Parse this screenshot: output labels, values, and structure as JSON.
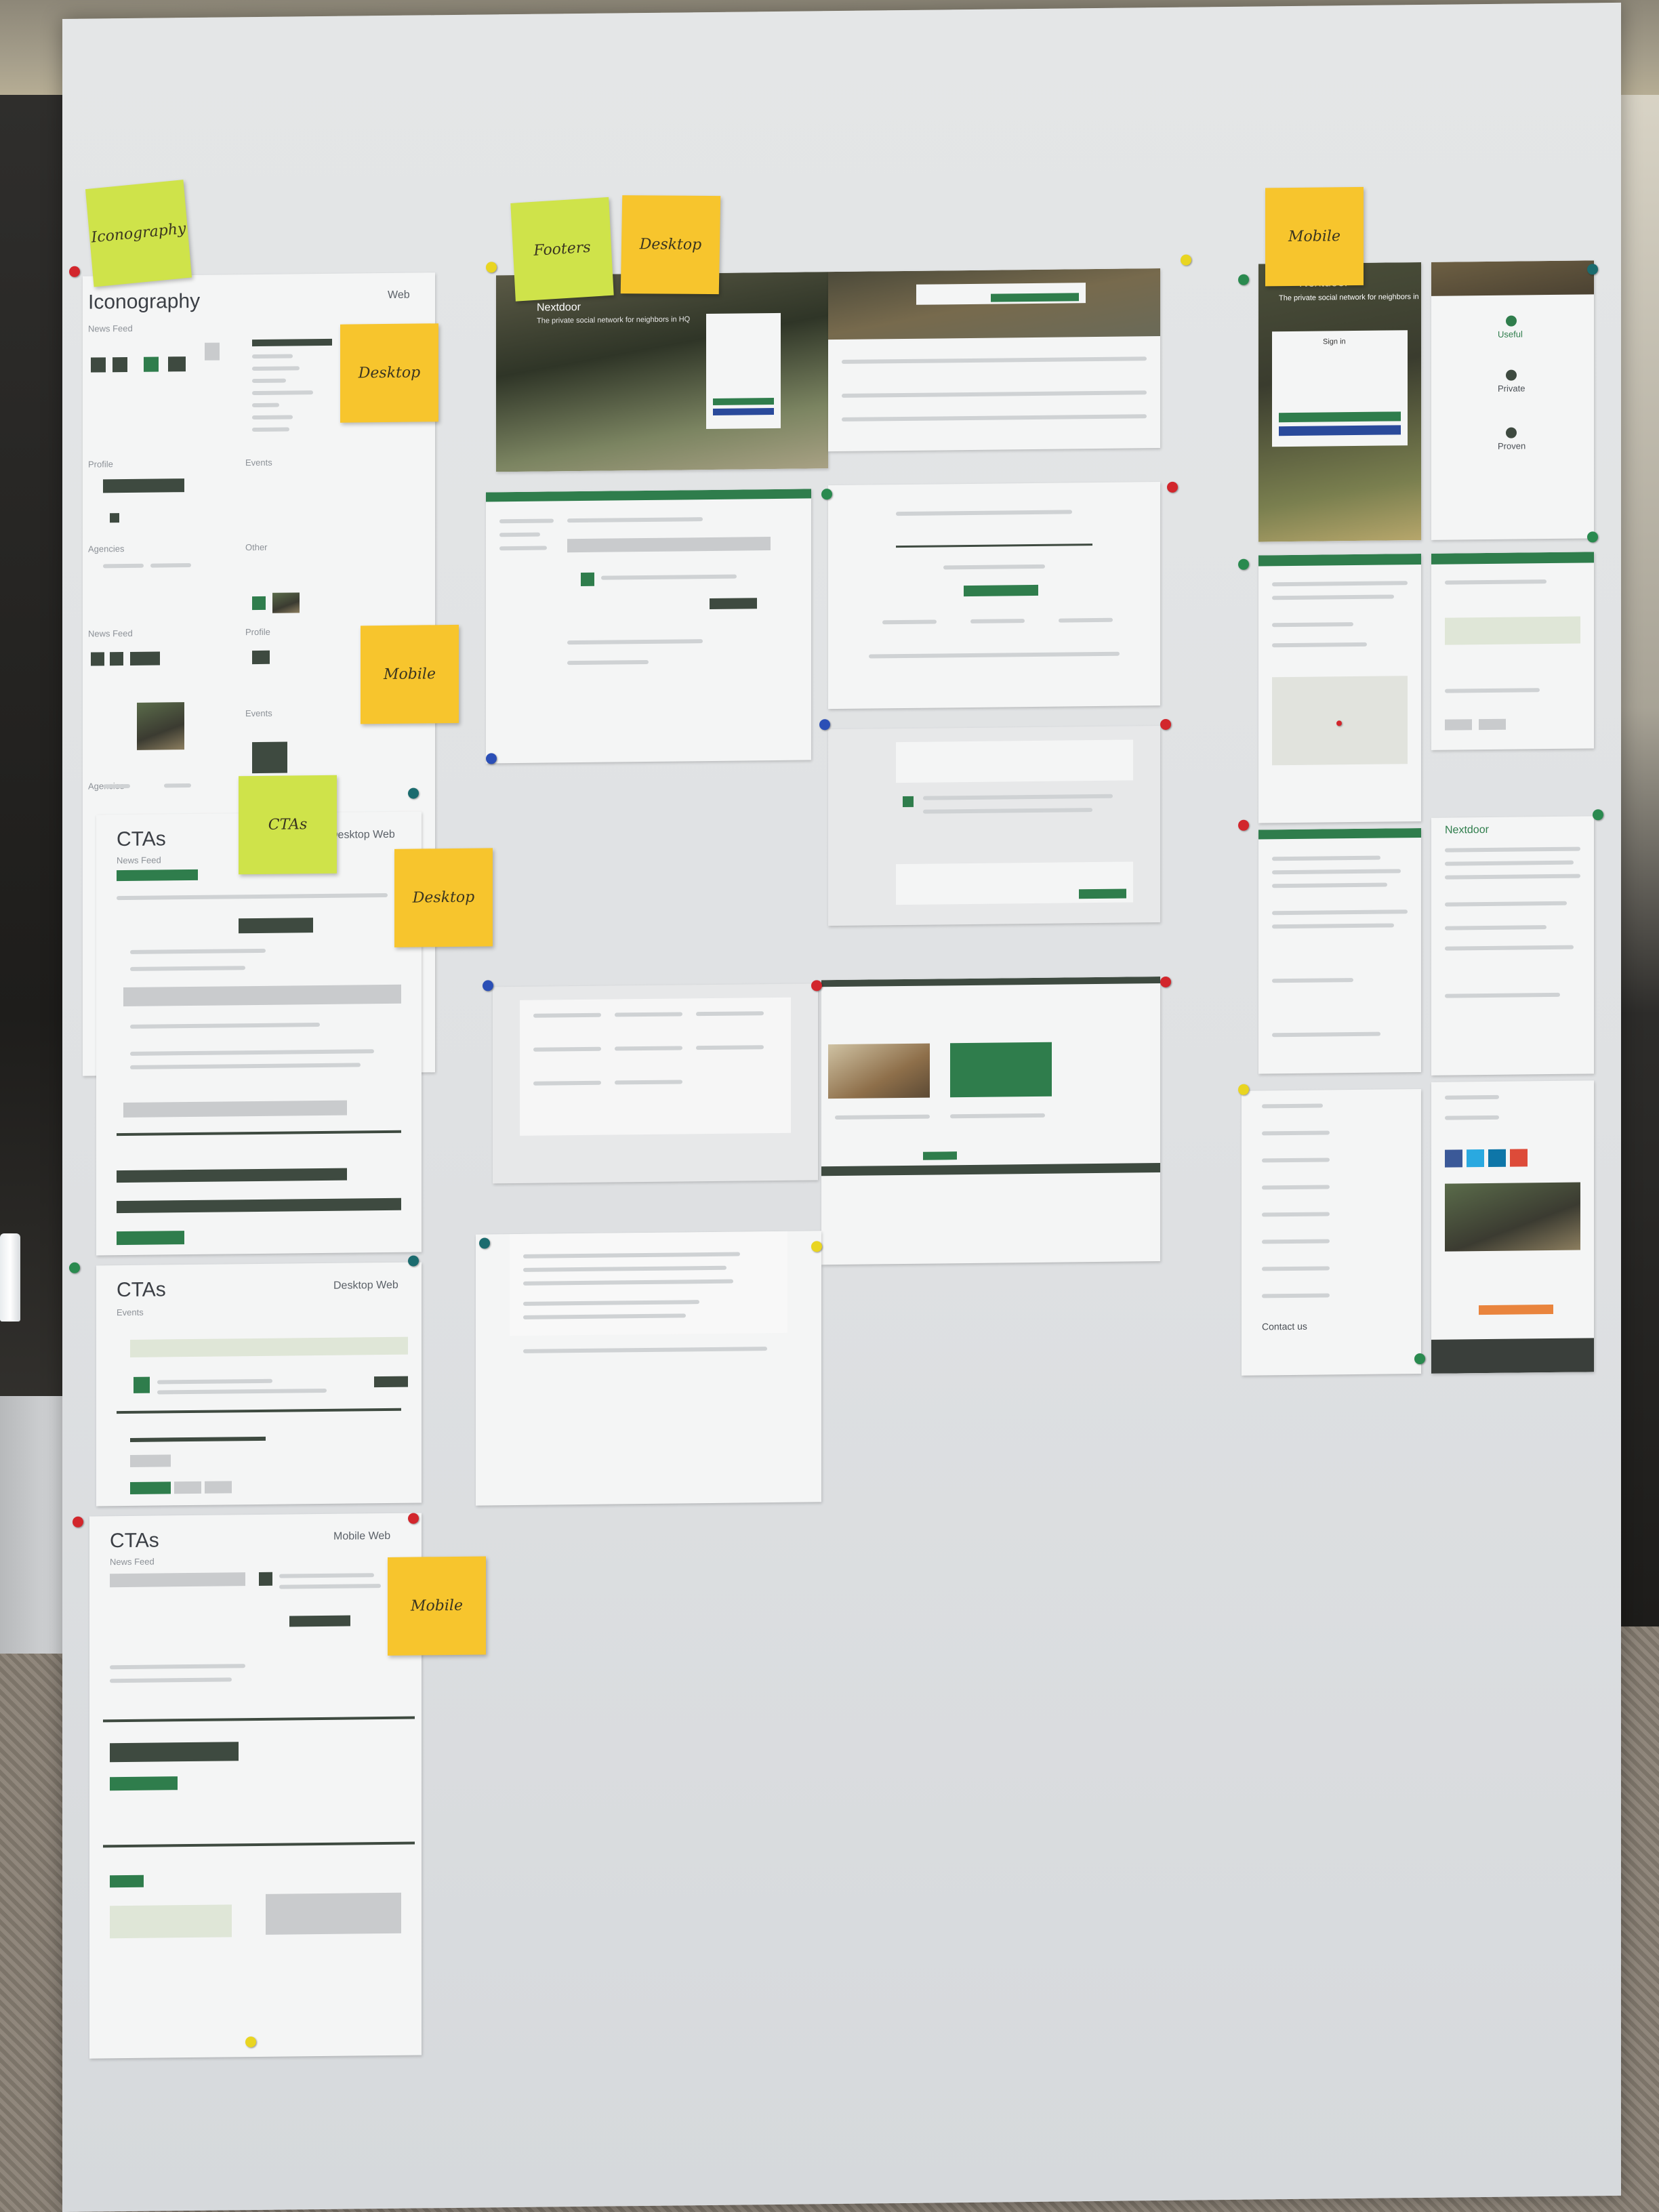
{
  "stickies": {
    "iconography": "Iconography",
    "footers": "Footers",
    "desktop_top": "Desktop",
    "mobile_top": "Mobile",
    "desktop_icon": "Desktop",
    "mobile_icon": "Mobile",
    "ctas": "CTAs",
    "desktop_cta": "Desktop",
    "mobile_cta": "Mobile"
  },
  "sheets": {
    "iconography": {
      "title": "Iconography",
      "corner": "Web",
      "sec1": "News Feed",
      "sec2": "Profile",
      "sec3": "Events",
      "sec4": "Agencies",
      "sec5": "Other",
      "sec6": "News Feed",
      "sec7": "Profile",
      "sec8": "Events",
      "sec9": "Agencies"
    },
    "cta1": {
      "title": "CTAs",
      "corner": "Desktop Web",
      "sub": "News Feed"
    },
    "cta2": {
      "title": "CTAs",
      "corner": "Desktop Web",
      "sub": "Events"
    },
    "cta3": {
      "title": "CTAs",
      "corner": "Mobile Web",
      "sub": "News Feed"
    },
    "footer_brand": "Nextdoor",
    "footer_tagline": "The private social network for neighbors in HQ",
    "mobile_brand": "Nextdoor",
    "mobile_tagline": "The private social network for neighbors in HQ",
    "mobile_signin": "Sign in",
    "mobile_useful": "Useful",
    "mobile_private": "Private",
    "mobile_proven": "Proven",
    "mobile_brand2": "Nextdoor",
    "contact_us": "Contact us"
  }
}
